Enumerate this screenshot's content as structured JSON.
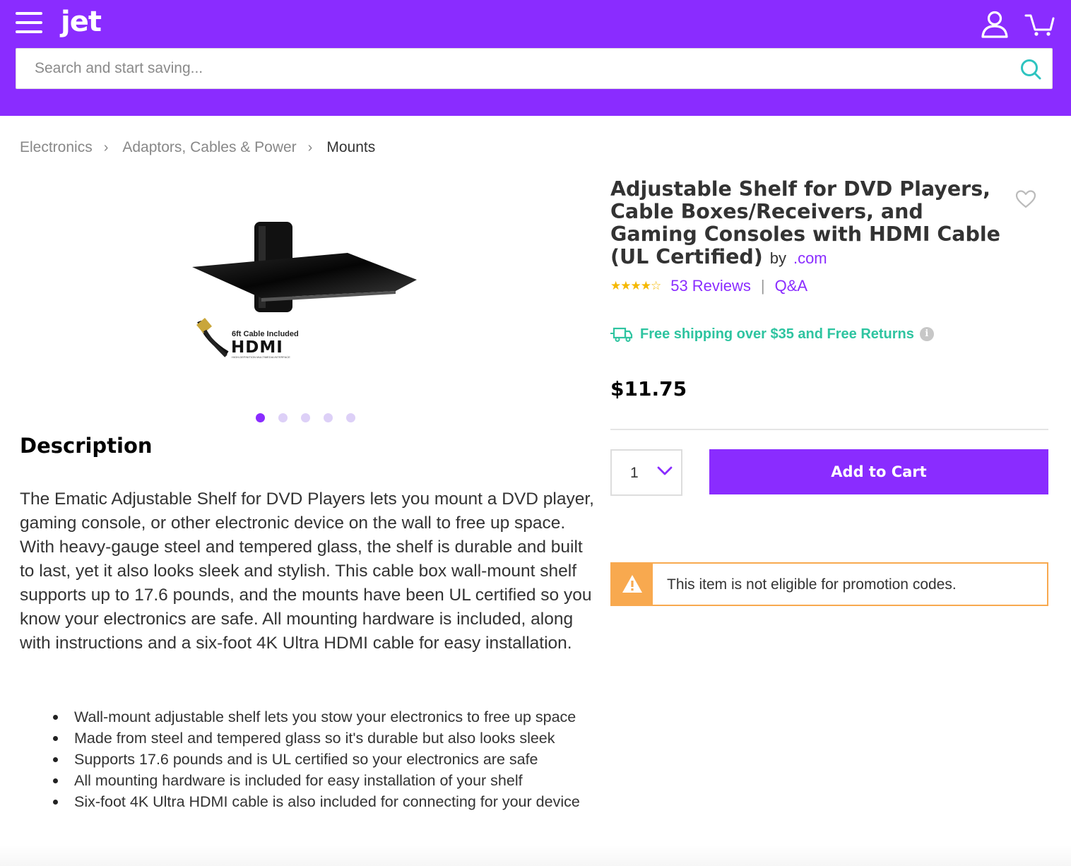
{
  "header": {
    "logo": "jet",
    "search_placeholder": "Search and start saving..."
  },
  "breadcrumb": [
    "Electronics",
    "Adaptors, Cables & Power",
    "Mounts"
  ],
  "product_image": {
    "caption_small": "6ft Cable Included",
    "caption_brand": "HDMI",
    "caption_tiny": "HIGH-DEFINITION MULTIMEDIA INTERFACE"
  },
  "carousel": {
    "count": 5,
    "active": 1
  },
  "description": {
    "title": "Description",
    "text": "The Ematic Adjustable Shelf for DVD Players lets you mount a DVD player, gaming console, or other electronic device on the wall to free up space. With heavy-gauge steel and tempered glass, the shelf is durable and built to last, yet it also looks sleek and stylish. This cable box wall-mount shelf supports up to 17.6 pounds, and the mounts have been UL certified so you know your electronics are safe. All mounting hardware is included, along with instructions and a six-foot 4K Ultra HDMI cable for easy installation.",
    "bullets": [
      "Wall-mount adjustable shelf lets you stow your electronics to free up space",
      "Made from steel and tempered glass so it's durable but also looks sleek",
      "Supports 17.6 pounds and is UL certified so your electronics are safe",
      "All mounting hardware is included for easy installation of your shelf",
      "Six-foot 4K Ultra HDMI cable is also included for connecting for your device"
    ]
  },
  "product": {
    "title": "Adjustable Shelf for DVD Players, Cable Boxes/Receivers, and Gaming Consoles with HDMI Cable (UL Certified)",
    "by": "by",
    "brand": ".com",
    "rating": 4.5,
    "stars": "★★★★☆",
    "reviews": "53 Reviews",
    "separator": "|",
    "qa": "Q&A",
    "shipping": "Free shipping over $35 and Free Returns",
    "info": "i",
    "price": "$11.75",
    "quantity": "1",
    "add_to_cart": "Add to Cart",
    "promo_notice": "This item is not eligible for promotion codes."
  },
  "colors": {
    "brand": "#8a2cff",
    "shipping": "#2ec4a0",
    "warning": "#f8a94f",
    "stars": "#f5b800"
  },
  "icons": [
    "menu-icon",
    "user-icon",
    "cart-icon",
    "search-icon",
    "chevron-right-icon",
    "heart-icon",
    "truck-icon",
    "info-icon",
    "chevron-down-icon",
    "warning-icon"
  ]
}
